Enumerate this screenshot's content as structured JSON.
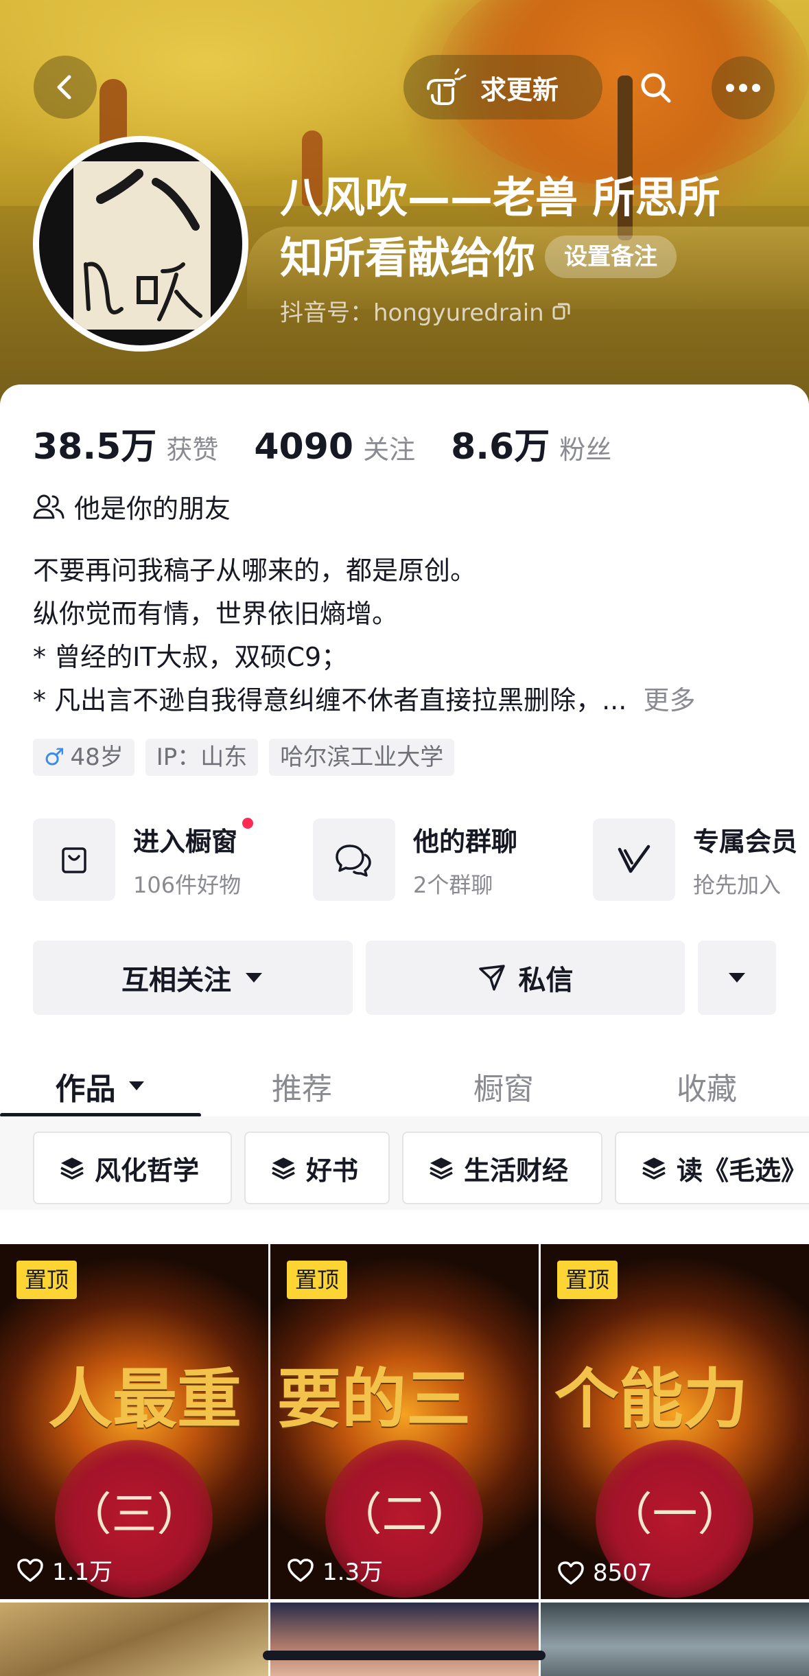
{
  "header": {
    "update_button": "求更新",
    "nickname": "八风吹——老兽 所思所知所看献给你",
    "remark_button": "设置备注",
    "douyin_id": "抖音号：hongyuredrain"
  },
  "stats": [
    {
      "value": "38.5万",
      "label": "获赞"
    },
    {
      "value": "4090",
      "label": "关注"
    },
    {
      "value": "8.6万",
      "label": "粉丝"
    }
  ],
  "friend_text": "他是你的朋友",
  "bio": {
    "lines": [
      "不要再问我稿子从哪来的，都是原创。",
      "纵你觉而有情，世界依旧熵增。",
      "* 曾经的IT大叔，双硕C9；",
      "* 凡出言不逊自我得意纠缠不休者直接拉黑删除，..."
    ],
    "more": "更多"
  },
  "tags": [
    {
      "icon": "male-icon",
      "text": "48岁"
    },
    {
      "text": "IP：山东"
    },
    {
      "text": "哈尔滨工业大学"
    }
  ],
  "services": [
    {
      "icon": "shopping-bag-icon",
      "title": "进入橱窗",
      "subtitle": "106件好物"
    },
    {
      "icon": "group-chat-icon",
      "title": "他的群聊",
      "subtitle": "2个群聊"
    },
    {
      "icon": "vip-v-icon",
      "title": "专属会员",
      "subtitle": "抢先加入"
    }
  ],
  "actions": {
    "follow": "互相关注",
    "message": "私信"
  },
  "tabs": [
    {
      "label": "作品",
      "active": true
    },
    {
      "label": "推荐"
    },
    {
      "label": "橱窗"
    },
    {
      "label": "收藏"
    }
  ],
  "collections": [
    "风化哲学",
    "好书",
    "生活财经",
    "读《毛选》"
  ],
  "videos": [
    {
      "pin": "置顶",
      "numeral": "（三）",
      "likes": "1.1万",
      "headline": "人最重"
    },
    {
      "pin": "置顶",
      "numeral": "（二）",
      "likes": "1.3万",
      "headline": "要的三"
    },
    {
      "pin": "置顶",
      "numeral": "（一）",
      "likes": "8507",
      "headline": "个能力"
    }
  ],
  "colors": {
    "accent_red": "#fe2c55",
    "pin_yellow": "#fcd535",
    "text_primary": "#161823",
    "text_secondary": "#8a8b91"
  }
}
